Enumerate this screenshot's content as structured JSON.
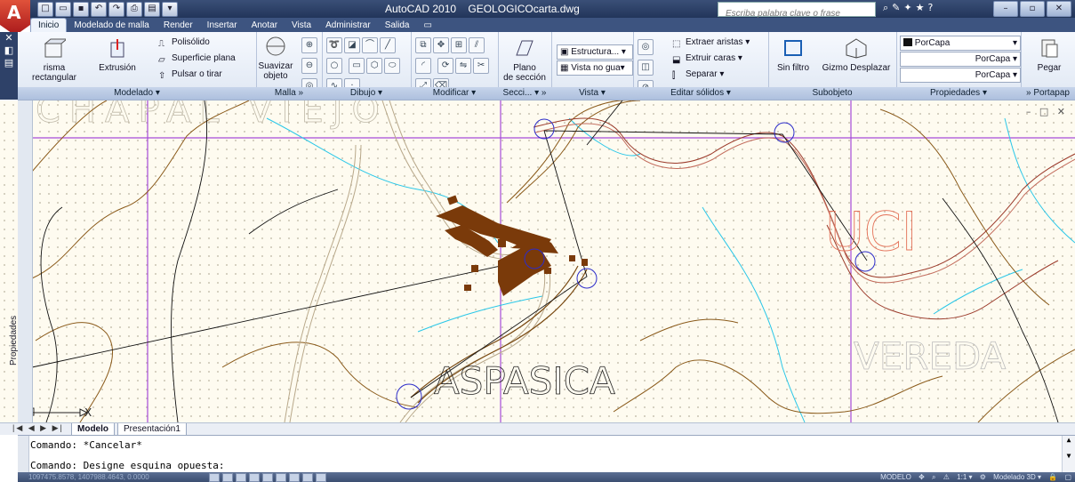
{
  "app": {
    "logo_letter": "A",
    "title": "AutoCAD 2010    GEOLOGICOcarta.dwg",
    "search_placeholder": "Escriba palabra clave o frase"
  },
  "tabs": [
    "Inicio",
    "Modelado de malla",
    "Render",
    "Insertar",
    "Anotar",
    "Vista",
    "Administrar",
    "Salida"
  ],
  "ribbon": {
    "modelado": {
      "title": "Modelado",
      "prisma": "risma rectangular",
      "extrusion": "Extrusión",
      "polisolido": "Polisólido",
      "superficie": "Superficie plana",
      "pulsar": "Pulsar o tirar"
    },
    "malla": {
      "title": "Malla",
      "suavizar_1": "Suavizar",
      "suavizar_2": "objeto"
    },
    "dibujo": {
      "title": "Dibujo"
    },
    "modificar": {
      "title": "Modificar"
    },
    "seccion": {
      "title": "Secci...",
      "plano_1": "Plano",
      "plano_2": "de sección"
    },
    "vista": {
      "title": "Vista",
      "estructura": "Estructura...",
      "vista_no_gua": "Vista no gua"
    },
    "editar": {
      "title": "Editar sólidos",
      "extraer": "Extraer aristas",
      "extruir": "Extruir caras",
      "separar": "Separar"
    },
    "subobjeto": {
      "title": "Subobjeto",
      "sin_filtro": "Sin filtro",
      "gizmo": "Gizmo Desplazar"
    },
    "propiedades": {
      "title": "Propiedades",
      "color": "PorCapa",
      "linetype": "PorCapa",
      "lineweight": "PorCapa"
    },
    "portapapeles": {
      "title": "Portapap",
      "pegar": "Pegar"
    }
  },
  "drawing": {
    "label_top": "CHAPAL VIEJO",
    "label_main": "ASPASICA",
    "label_right": "VEREDA",
    "label_partial": "UCI",
    "axis_x": "X",
    "viewport_controls": "– □ ✕"
  },
  "left_palette": {
    "label": "Propiedades"
  },
  "layout_tabs": [
    "Modelo",
    "Presentación1"
  ],
  "command": {
    "line1": "Comando: *Cancelar*",
    "line2": "Comando: Designe esquina opuesta:"
  },
  "status": {
    "coords": "1097475.8578, 1407988.4643, 0.0000",
    "modelo": "MODELO",
    "scale": "1:1",
    "workspace": "Modelado 3D"
  },
  "colors": {
    "contour": "#8a5a1a",
    "road": "#b8a88a",
    "water": "#29c7e8",
    "grid": "#a64bd8",
    "building": "#7a3a0a",
    "circle": "#2c2cc9"
  }
}
